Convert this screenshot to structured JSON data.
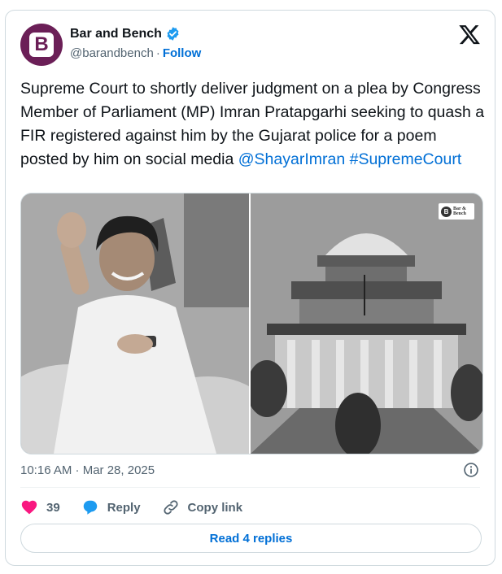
{
  "author": {
    "display_name": "Bar and Bench",
    "handle": "@barandbench",
    "separator": "·",
    "follow_label": "Follow",
    "avatar_letter": "B",
    "avatar_color": "#6b1f57"
  },
  "tweet": {
    "text": "Supreme Court to shortly deliver judgment on a plea by Congress Member of Parliament (MP) Imran Pratapgarhi seeking to quash a FIR registered against him by the Gujarat police for a poem posted by him on social media",
    "mention": "@ShayarImran",
    "hashtag": "#SupremeCourt",
    "link_color": "#006fd6"
  },
  "media": {
    "watermark_line1": "Bar &",
    "watermark_line2": "Bench",
    "watermark_icon": "B"
  },
  "meta": {
    "timestamp": "10:16 AM · Mar 28, 2025"
  },
  "actions": {
    "like_count": "39",
    "reply_label": "Reply",
    "copy_link_label": "Copy link",
    "like_color": "#f91880",
    "reply_color": "#1d9bf0"
  },
  "footer": {
    "read_replies_label": "Read 4 replies"
  },
  "icons": [
    "verified-badge-icon",
    "x-logo-icon",
    "info-icon",
    "heart-icon",
    "reply-bubble-icon",
    "link-icon"
  ]
}
